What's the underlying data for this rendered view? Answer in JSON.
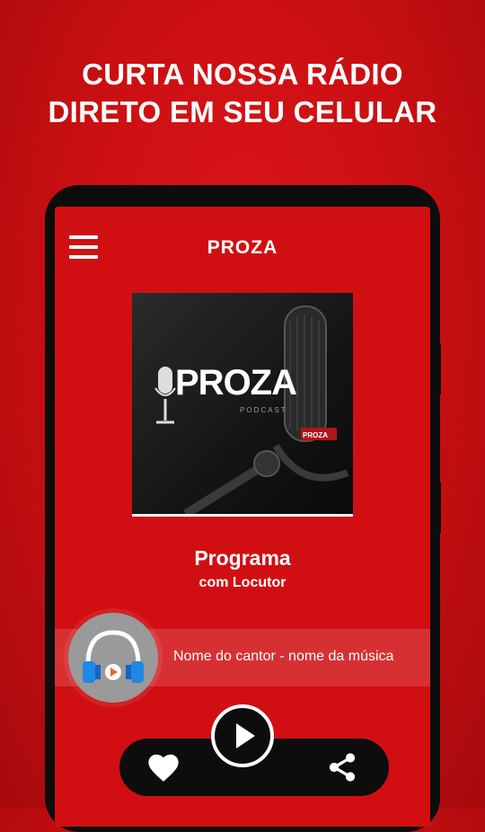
{
  "promo": {
    "line1": "CURTA NOSSA RÁDIO",
    "line2": "DIRETO EM SEU CELULAR"
  },
  "app": {
    "title": "PROZA"
  },
  "cover": {
    "logo_text": "PROZA",
    "logo_sub": "PODCAST"
  },
  "program": {
    "title": "Programa",
    "host": "com Locutor"
  },
  "now_playing": {
    "text": "Nome do cantor - nome da música"
  },
  "icons": {
    "menu": "menu-icon",
    "headphones": "headphones-icon",
    "play": "play-icon",
    "heart": "heart-icon",
    "share": "share-icon"
  },
  "colors": {
    "background_red": "#d10f12",
    "phone_black": "#0d0d0d",
    "text_white": "#ffffff",
    "headphone_blue": "#1e88e5",
    "play_orange": "#f26522"
  }
}
